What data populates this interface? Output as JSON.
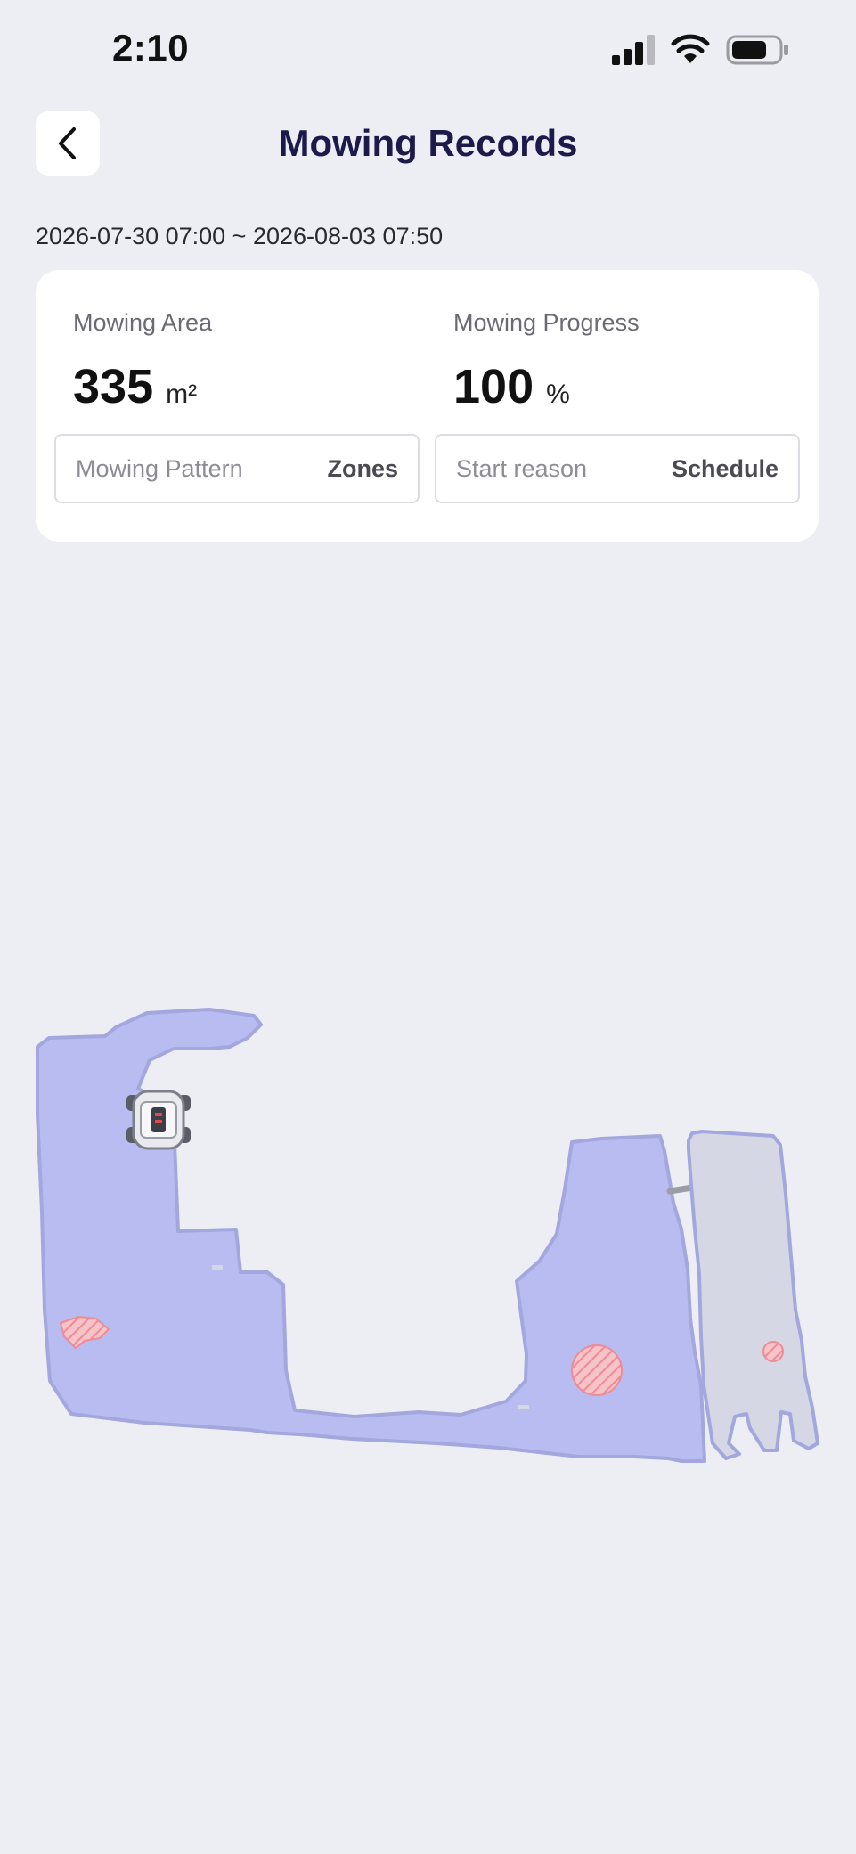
{
  "status_bar": {
    "time": "2:10"
  },
  "header": {
    "title": "Mowing Records"
  },
  "record": {
    "date_range": "2026-07-30 07:00 ~ 2026-08-03 07:50",
    "mowing_area": {
      "label": "Mowing Area",
      "value": "335",
      "unit": "m²"
    },
    "mowing_progress": {
      "label": "Mowing Progress",
      "value": "100",
      "unit": "%"
    },
    "mowing_pattern": {
      "label": "Mowing Pattern",
      "value": "Zones"
    },
    "start_reason": {
      "label": "Start reason",
      "value": "Schedule"
    }
  },
  "map": {
    "colors": {
      "mowed_zone": "#b8bcf0",
      "zone_border": "#a3a7de",
      "unmowed_zone": "#d5d7e4",
      "obstacle": "#ee8b95"
    }
  },
  "icons": {
    "back": "chevron-left-icon",
    "signal": "signal-bars-icon",
    "wifi": "wifi-icon",
    "battery": "battery-icon",
    "mower": "robot-mower-icon"
  }
}
